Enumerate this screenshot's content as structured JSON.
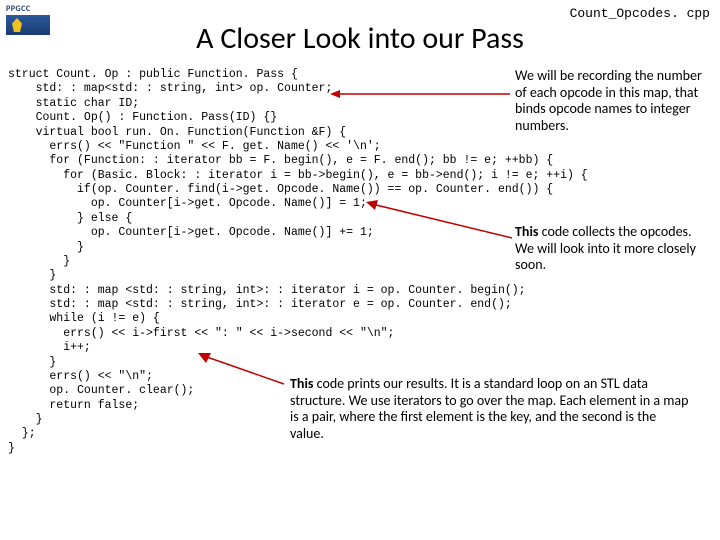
{
  "filename": "Count_Opcodes. cpp",
  "logo_text": "PPGCC",
  "title": "A Closer Look into our Pass",
  "code": "struct Count. Op : public Function. Pass {\n    std: : map<std: : string, int> op. Counter;\n    static char ID;\n    Count. Op() : Function. Pass(ID) {}\n    virtual bool run. On. Function(Function &F) {\n      errs() << \"Function \" << F. get. Name() << '\\n';\n      for (Function: : iterator bb = F. begin(), e = F. end(); bb != e; ++bb) {\n        for (Basic. Block: : iterator i = bb->begin(), e = bb->end(); i != e; ++i) {\n          if(op. Counter. find(i->get. Opcode. Name()) == op. Counter. end()) {\n            op. Counter[i->get. Opcode. Name()] = 1;\n          } else {\n            op. Counter[i->get. Opcode. Name()] += 1;\n          }\n        }\n      }\n      std: : map <std: : string, int>: : iterator i = op. Counter. begin();\n      std: : map <std: : string, int>: : iterator e = op. Counter. end();\n      while (i != e) {\n        errs() << i->first << \": \" << i->second << \"\\n\";\n        i++;\n      }\n      errs() << \"\\n\";\n      op. Counter. clear();\n      return false;\n    }\n  };\n}",
  "annotations": {
    "a1": "We will be recording the number of each opcode in this map, that binds opcode names to integer numbers.",
    "a2_bold": "This",
    "a2_rest": " code collects the opcodes. We will look into it more closely soon.",
    "a3_bold": "This",
    "a3_rest": " code prints our results. It is a standard loop on an STL data structure. We use iterators to go over the map. Each element in a map is a pair, where the first element is the key, and the second is the value."
  }
}
